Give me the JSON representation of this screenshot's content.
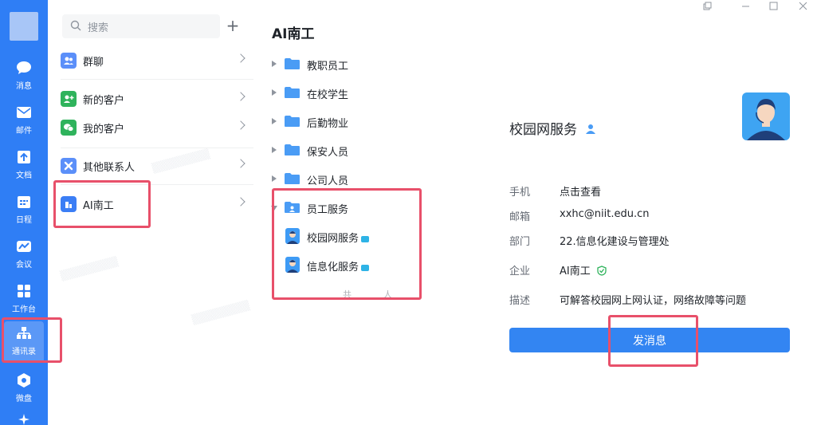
{
  "rail": {
    "items": [
      {
        "label": "消息",
        "icon": "chat-icon"
      },
      {
        "label": "邮件",
        "icon": "mail-icon"
      },
      {
        "label": "文档",
        "icon": "doc-icon"
      },
      {
        "label": "日程",
        "icon": "calendar-icon"
      },
      {
        "label": "会议",
        "icon": "meeting-icon"
      },
      {
        "label": "工作台",
        "icon": "workbench-icon"
      },
      {
        "label": "通讯录",
        "icon": "org-chart-icon",
        "active": true
      },
      {
        "label": "微盘",
        "icon": "drive-icon"
      }
    ]
  },
  "contacts": {
    "search_placeholder": "搜索",
    "items": [
      {
        "label": "群聊",
        "icon": "group-chat-icon",
        "color": "#5b8ff9"
      },
      {
        "label": "新的客户",
        "icon": "add-customer-icon",
        "color": "#2fb35c"
      },
      {
        "label": "我的客户",
        "icon": "wechat-icon",
        "color": "#2fb35c"
      },
      {
        "label": "其他联系人",
        "icon": "other-contacts-icon",
        "color": "#5b8ff9"
      },
      {
        "label": "AI南工",
        "icon": "org-building-icon",
        "color": "#3b7ef5"
      }
    ]
  },
  "tree": {
    "title": "AI南工",
    "folders": [
      {
        "label": "教职员工",
        "expanded": false
      },
      {
        "label": "在校学生",
        "expanded": false
      },
      {
        "label": "后勤物业",
        "expanded": false
      },
      {
        "label": "保安人员",
        "expanded": false
      },
      {
        "label": "公司人员",
        "expanded": false
      },
      {
        "label": "员工服务",
        "expanded": true
      }
    ],
    "members": [
      {
        "label": "校园网服务"
      },
      {
        "label": "信息化服务"
      }
    ],
    "count_text": "共人"
  },
  "detail": {
    "name": "校园网服务",
    "fields": [
      {
        "key": "手机",
        "value": "点击查看"
      },
      {
        "key": "邮箱",
        "value": "xxhc@niit.edu.cn"
      },
      {
        "key": "部门",
        "value": "22.信息化建设与管理处"
      },
      {
        "key": "企业",
        "value": "AI南工"
      },
      {
        "key": "描述",
        "value": "可解答校园网上网认证，网络故障等问题"
      }
    ],
    "send_button": "发消息"
  },
  "colors": {
    "rail_bg": "#2f7ef5",
    "accent": "#3385f2",
    "annotation": "#e8506a"
  }
}
